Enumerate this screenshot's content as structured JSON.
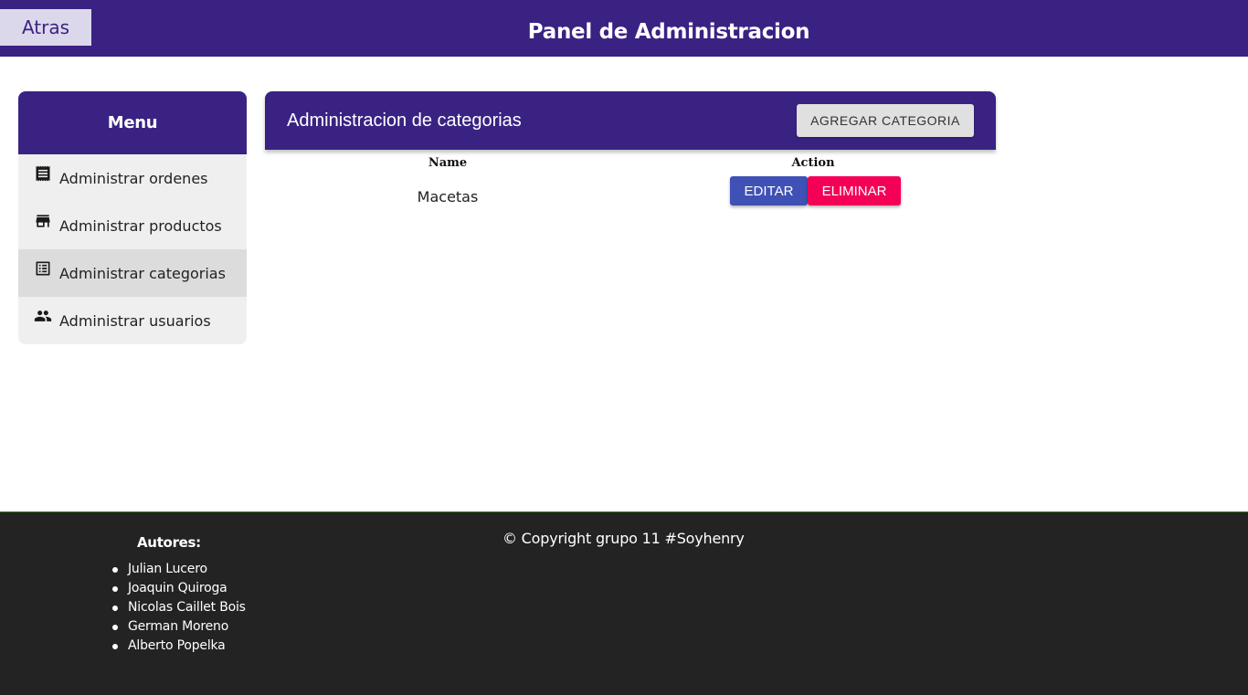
{
  "header": {
    "back_label": "Atras",
    "title": "Panel de Administracion"
  },
  "menu": {
    "title": "Menu",
    "items": [
      {
        "label": "Administrar ordenes",
        "icon": "receipt-icon",
        "active": false
      },
      {
        "label": "Administrar productos",
        "icon": "store-icon",
        "active": false
      },
      {
        "label": "Administrar categorias",
        "icon": "list-alt-icon",
        "active": true
      },
      {
        "label": "Administrar usuarios",
        "icon": "people-icon",
        "active": false
      }
    ]
  },
  "panel": {
    "title": "Administracion de categorias",
    "add_label": "AGREGAR CATEGORIA",
    "columns": [
      "Name",
      "Action"
    ],
    "rows": [
      {
        "name": "Macetas",
        "edit_label": "EDITAR",
        "delete_label": "ELIMINAR"
      }
    ]
  },
  "footer": {
    "authors_title": "Autores:",
    "authors": [
      "Julian Lucero",
      "Joaquin Quiroga",
      "Nicolas Caillet Bois",
      "German Moreno",
      "Alberto Popelka"
    ],
    "copyright": "© Copyright grupo 11 #Soyhenry"
  },
  "colors": {
    "primary": "#3a2283",
    "edit": "#3f51b5",
    "delete": "#f50057",
    "footer": "#232323"
  }
}
